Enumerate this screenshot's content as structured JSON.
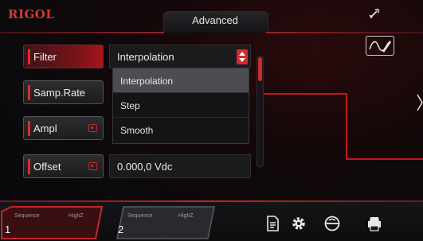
{
  "header": {
    "brand": "RIGOL",
    "title": "Advanced"
  },
  "params": [
    {
      "label": "Filter",
      "value": "Interpolation"
    },
    {
      "label": "Samp.Rate",
      "value": ""
    },
    {
      "label": "Ampl",
      "value": ""
    },
    {
      "label": "Offset",
      "value": "0.000,0 Vdc"
    }
  ],
  "dropdown": {
    "options": [
      "Interpolation",
      "Step",
      "Smooth"
    ],
    "highlighted_index": 0
  },
  "channels": [
    {
      "number": "1",
      "mode": "Sequence",
      "load": "HighZ"
    },
    {
      "number": "2",
      "mode": "Sequence",
      "load": "HighZ"
    }
  ],
  "icons": {
    "usb": "usb-icon",
    "waveform_edit": "waveform-edit-icon",
    "bottom": [
      "document-icon",
      "settings-gear-icon",
      "network-icon",
      "printer-icon"
    ]
  },
  "colors": {
    "accent": "#d42a2d",
    "brand": "#d23a35",
    "waveform": "#c4161c"
  }
}
